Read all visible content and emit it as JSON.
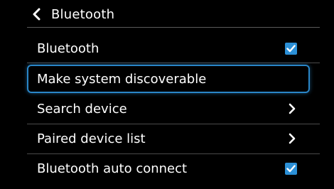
{
  "header": {
    "title": "Bluetooth",
    "back_icon": "chevron-left-icon"
  },
  "settings": {
    "items": [
      {
        "label": "Bluetooth",
        "control": "checkbox",
        "checked": true
      },
      {
        "label": "Make system discoverable",
        "control": "none",
        "focused": true
      },
      {
        "label": "Search device",
        "control": "chevron"
      },
      {
        "label": "Paired device list",
        "control": "chevron"
      },
      {
        "label": "Bluetooth auto connect",
        "control": "checkbox",
        "checked": true
      }
    ]
  },
  "colors": {
    "accent": "#2b8fd6",
    "focus_border": "#2a86c8",
    "background": "#000000",
    "text": "#ffffff"
  }
}
